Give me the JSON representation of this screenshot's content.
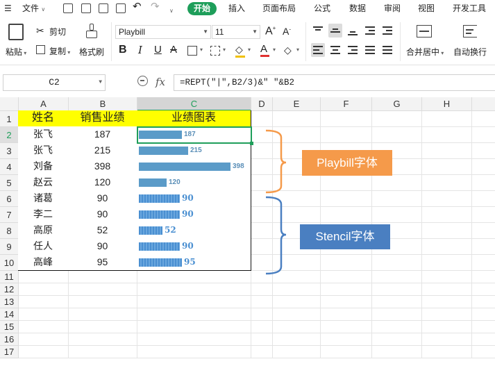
{
  "menubar": {
    "file": "文件",
    "tabs": [
      "开始",
      "插入",
      "页面布局",
      "公式",
      "数据",
      "审阅",
      "视图",
      "开发工具"
    ]
  },
  "ribbon": {
    "cut": "剪切",
    "paste": "粘贴",
    "copy": "复制",
    "format_painter": "格式刷",
    "font_name": "Playbill",
    "font_size": "11",
    "merge_center": "合并居中",
    "wrap_text": "自动换行"
  },
  "formula_bar": {
    "cell_ref": "C2",
    "fx": "fx",
    "formula": "=REPT(\"|\",B2/3)&\" \"&B2"
  },
  "sheet": {
    "columns": [
      "A",
      "B",
      "C",
      "D",
      "E",
      "F",
      "G",
      "H"
    ],
    "rows": [
      "1",
      "2",
      "3",
      "4",
      "5",
      "6",
      "7",
      "8",
      "9",
      "10",
      "11",
      "12",
      "13",
      "14",
      "15",
      "16",
      "17"
    ],
    "headers": [
      "姓名",
      "销售业绩",
      "业绩图表"
    ],
    "records": [
      {
        "name": "张飞",
        "sales": "187",
        "font": "Playbill"
      },
      {
        "name": "张飞",
        "sales": "215",
        "font": "Playbill"
      },
      {
        "name": "刘备",
        "sales": "398",
        "font": "Playbill"
      },
      {
        "name": "赵云",
        "sales": "120",
        "font": "Playbill"
      },
      {
        "name": "诸葛",
        "sales": "90",
        "font": "Stencil"
      },
      {
        "name": "李二",
        "sales": "90",
        "font": "Stencil"
      },
      {
        "name": "高原",
        "sales": "52",
        "font": "Stencil"
      },
      {
        "name": "任人",
        "sales": "90",
        "font": "Stencil"
      },
      {
        "name": "高峰",
        "sales": "95",
        "font": "Stencil"
      }
    ]
  },
  "annotations": {
    "playbill_label": "Playbill字体",
    "playbill_color": "#f59a4a",
    "stencil_label": "Stencil字体",
    "stencil_color": "#4a7fc1"
  }
}
